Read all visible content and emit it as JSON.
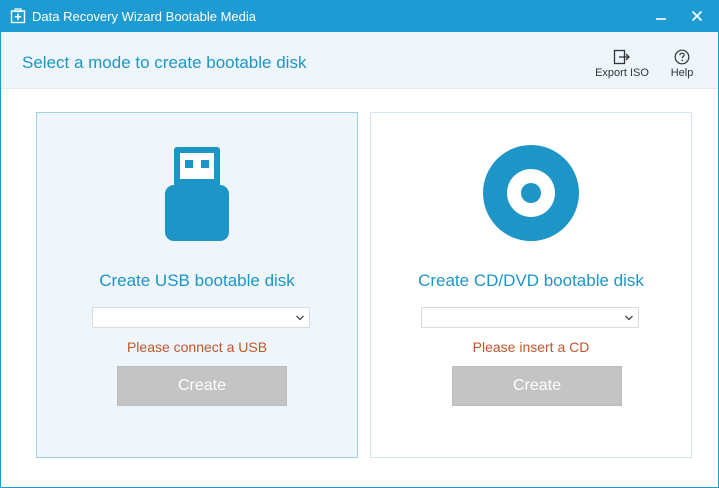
{
  "window": {
    "title": "Data Recovery Wizard Bootable Media",
    "accent_color": "#1f9bd3"
  },
  "header": {
    "title": "Select a mode to create bootable disk",
    "tools": {
      "export_iso": {
        "label": "Export ISO",
        "icon": "export-icon"
      },
      "help": {
        "label": "Help",
        "icon": "help-icon"
      }
    }
  },
  "usb": {
    "icon": "usb-drive-icon",
    "title": "Create USB bootable disk",
    "select_value": "",
    "status": "Please connect a USB",
    "button": "Create"
  },
  "cd": {
    "icon": "cd-disc-icon",
    "title": "Create CD/DVD bootable disk",
    "select_value": "",
    "status": "Please insert a CD",
    "button": "Create"
  },
  "colors": {
    "brand_blue": "#1e95c7",
    "status_orange": "#c0562b",
    "disabled_button": "#c4c4c4"
  }
}
